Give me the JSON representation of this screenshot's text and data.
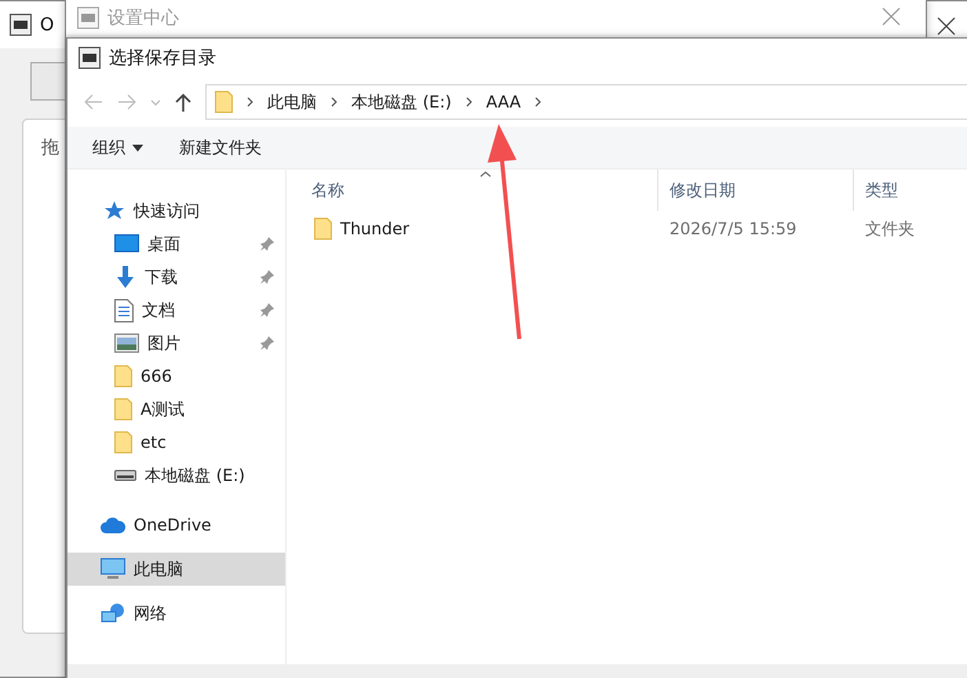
{
  "back_window": {
    "title": "O",
    "label": "拖"
  },
  "settings_window": {
    "title": "设置中心"
  },
  "dialog": {
    "title": "选择保存目录",
    "breadcrumb": [
      "此电脑",
      "本地磁盘 (E:)",
      "AAA"
    ],
    "toolbar": [
      {
        "label": "组织",
        "dropdown": true
      },
      {
        "label": "新建文件夹",
        "dropdown": false
      }
    ],
    "sidebar": [
      {
        "label": "快速访问",
        "kind": "star",
        "selected": false,
        "children": [
          {
            "label": "桌面",
            "kind": "desktop",
            "pinned": true,
            "selected": false
          },
          {
            "label": "下载",
            "kind": "download",
            "pinned": true,
            "selected": false
          },
          {
            "label": "文档",
            "kind": "document",
            "pinned": true,
            "selected": false
          },
          {
            "label": "图片",
            "kind": "image",
            "pinned": true,
            "selected": false
          },
          {
            "label": "666",
            "kind": "folder",
            "pinned": false,
            "selected": false
          },
          {
            "label": "A测试",
            "kind": "folder",
            "pinned": false,
            "selected": false
          },
          {
            "label": "etc",
            "kind": "folder",
            "pinned": false,
            "selected": false
          },
          {
            "label": "本地磁盘 (E:)",
            "kind": "drive",
            "pinned": false,
            "selected": false
          }
        ]
      },
      {
        "label": "OneDrive",
        "kind": "cloud",
        "selected": false
      },
      {
        "label": "此电脑",
        "kind": "computer",
        "selected": true
      },
      {
        "label": "网络",
        "kind": "network",
        "selected": false
      }
    ],
    "columns": [
      {
        "label": "名称",
        "sorted": true
      },
      {
        "label": "修改日期",
        "sorted": false
      },
      {
        "label": "类型",
        "sorted": false
      }
    ],
    "rows": [
      {
        "name": "Thunder",
        "modified": "2026/7/5 15:59",
        "type": "文件夹",
        "selected": false
      }
    ]
  }
}
